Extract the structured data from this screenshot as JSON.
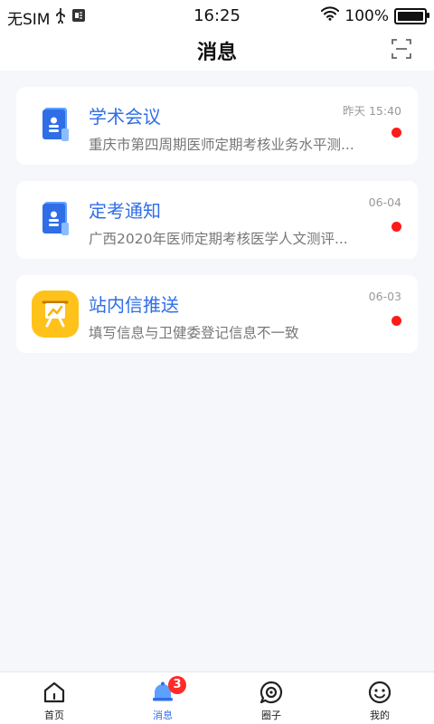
{
  "status_bar": {
    "carrier": "无SIM",
    "time": "16:25",
    "battery": "100%",
    "battery_level": 1.0
  },
  "header": {
    "title": "消息",
    "scan_icon": "scan-icon"
  },
  "messages": [
    {
      "title": "学术会议",
      "snippet": "重庆市第四周期医师定期考核业务水平测...",
      "time": "昨天 15:40",
      "unread": true,
      "icon": "document-person-icon"
    },
    {
      "title": "定考通知",
      "snippet": "广西2020年医师定期考核医学人文测评...",
      "time": "06-04",
      "unread": true,
      "icon": "document-person-icon"
    },
    {
      "title": "站内信推送",
      "snippet": "填写信息与卫健委登记信息不一致",
      "time": "06-03",
      "unread": true,
      "icon": "presentation-board-icon"
    }
  ],
  "tabbar": {
    "items": [
      {
        "label": "首页",
        "icon": "home-icon",
        "active": false
      },
      {
        "label": "消息",
        "icon": "bell-icon",
        "active": true,
        "badge": "3"
      },
      {
        "label": "圈子",
        "icon": "circle-target-icon",
        "active": false
      },
      {
        "label": "我的",
        "icon": "smiley-icon",
        "active": false
      }
    ]
  },
  "colors": {
    "accent": "#2f6ee7",
    "unread": "#ff1a1a",
    "background": "#f5f7fb"
  }
}
